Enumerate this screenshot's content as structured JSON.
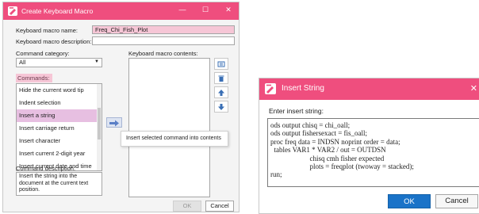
{
  "macro_dialog": {
    "title": "Create Keyboard Macro",
    "window_controls": {
      "minimize": "—",
      "maximize": "☐",
      "close": "✕"
    },
    "name_label": "Keyboard macro name:",
    "name_value": "Freq_Chi_Fish_Plot",
    "description_label": "Keyboard macro description:",
    "description_value": "",
    "category_label": "Command category:",
    "category_value": "All",
    "contents_label": "Keyboard macro contents:",
    "commands_label": "Commands:",
    "commands": [
      "Hide the current word tip",
      "Indent selection",
      "Insert a string",
      "Insert carriage return",
      "Insert character",
      "Insert current 2-digit year",
      "Insert current date and time"
    ],
    "selected_command_index": 2,
    "command_description_label": "Command description:",
    "command_description": "Insert the string into the document at the current text position.",
    "tooltip": "Insert selected command into contents",
    "ok_label": "OK",
    "cancel_label": "Cancel",
    "icons": [
      "insert-arrow-icon",
      "keyboard-icon",
      "trash-icon",
      "move-up-icon",
      "move-down-icon",
      "chevron-down-icon"
    ]
  },
  "insert_string_dialog": {
    "title": "Insert String",
    "close": "✕",
    "prompt": "Enter insert string:",
    "text_lines": [
      "ods output chisq = chi_oall;",
      "ods output fishersexact = fis_oall;",
      "proc freq data = INDSN noprint order = data;",
      "  tables VAR1 * VAR2 / out = OUTDSN",
      "                      chisq cmh fisher expected",
      "                      plots = freqplot (twoway = stacked);",
      "run;"
    ],
    "ok_label": "OK",
    "cancel_label": "Cancel"
  },
  "colors": {
    "accent": "#ef4e7e",
    "highlight": "#f6c6d6",
    "selection": "#e7bfe1",
    "primary_button": "#1a73c8"
  }
}
